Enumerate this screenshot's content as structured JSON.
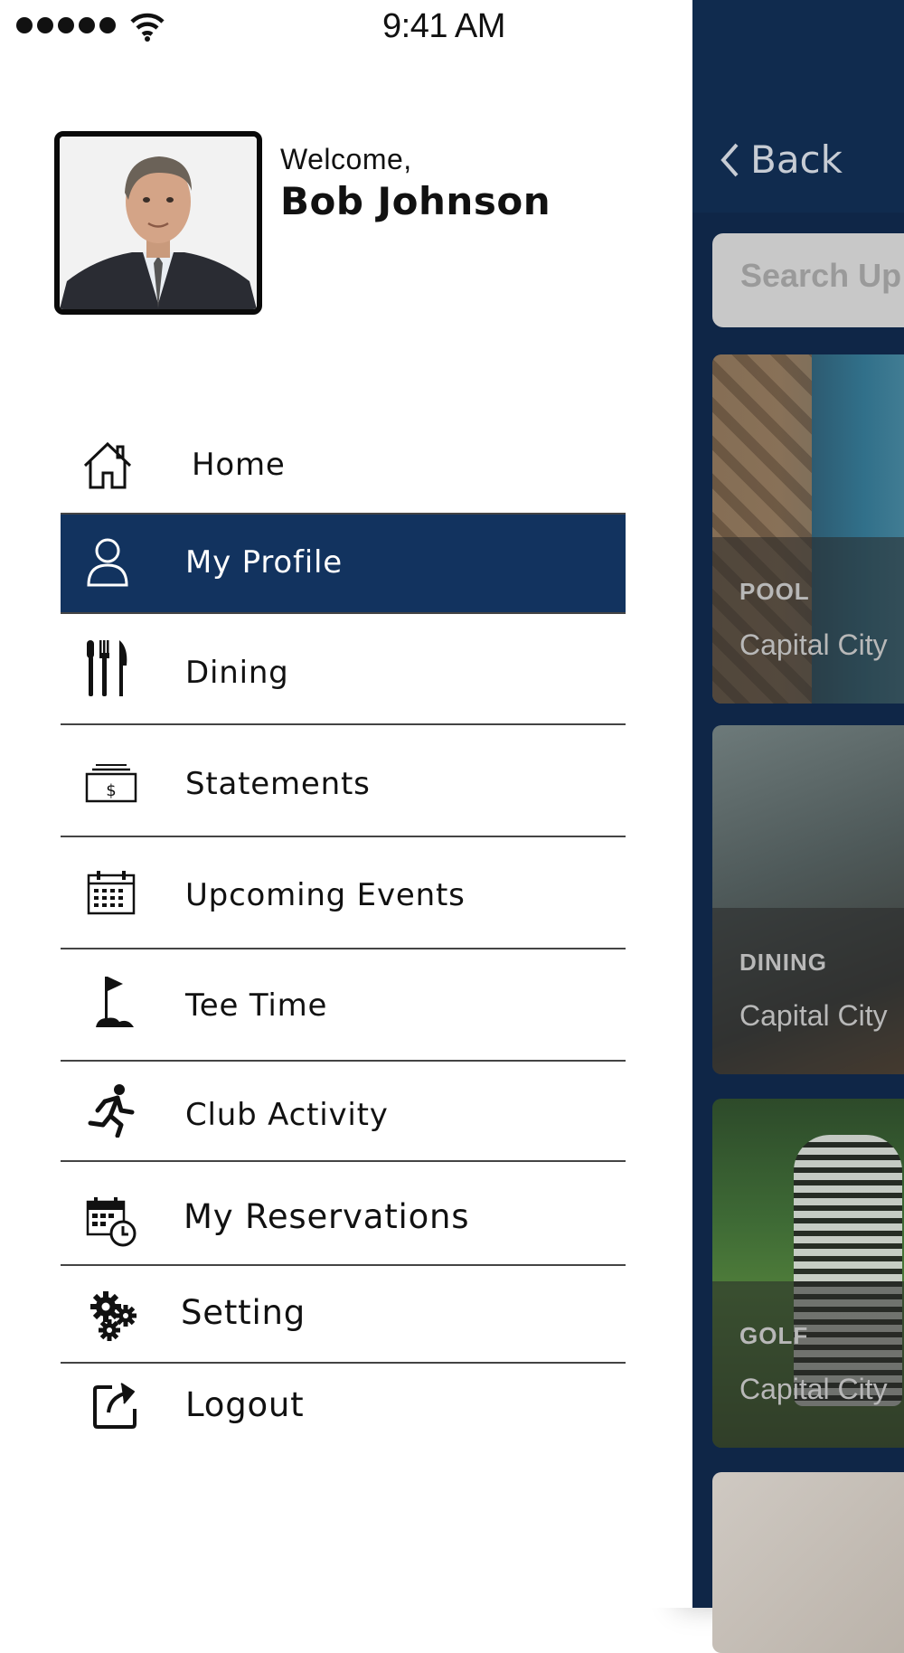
{
  "status_bar": {
    "time": "9:41 AM",
    "signal_icon": "signal-dots-icon",
    "wifi_icon": "wifi-icon"
  },
  "profile": {
    "welcome": "Welcome,",
    "name": "Bob Johnson",
    "avatar": "avatar-photo"
  },
  "menu": {
    "items": [
      {
        "label": "Home",
        "icon": "home-icon",
        "active": false
      },
      {
        "label": "My Profile",
        "icon": "user-icon",
        "active": true
      },
      {
        "label": "Dining",
        "icon": "cutlery-icon",
        "active": false
      },
      {
        "label": "Statements",
        "icon": "bill-icon",
        "active": false
      },
      {
        "label": "Upcoming Events",
        "icon": "calendar-icon",
        "active": false
      },
      {
        "label": "Tee Time",
        "icon": "golf-flag-icon",
        "active": false
      },
      {
        "label": "Club Activity",
        "icon": "running-icon",
        "active": false
      },
      {
        "label": "My Reservations",
        "icon": "calendar-clock-icon",
        "active": false
      },
      {
        "label": "Setting",
        "icon": "gears-icon",
        "active": false
      },
      {
        "label": "Logout",
        "icon": "logout-icon",
        "active": false
      }
    ]
  },
  "background_screen": {
    "back_label": "Back",
    "search_placeholder": "Search Up",
    "cards": [
      {
        "category": "POOL",
        "name": "Capital City"
      },
      {
        "category": "DINING",
        "name": "Capital City"
      },
      {
        "category": "GOLF",
        "name": "Capital City"
      }
    ]
  },
  "colors": {
    "accent": "#12335f",
    "background_panel": "#0f2647"
  }
}
